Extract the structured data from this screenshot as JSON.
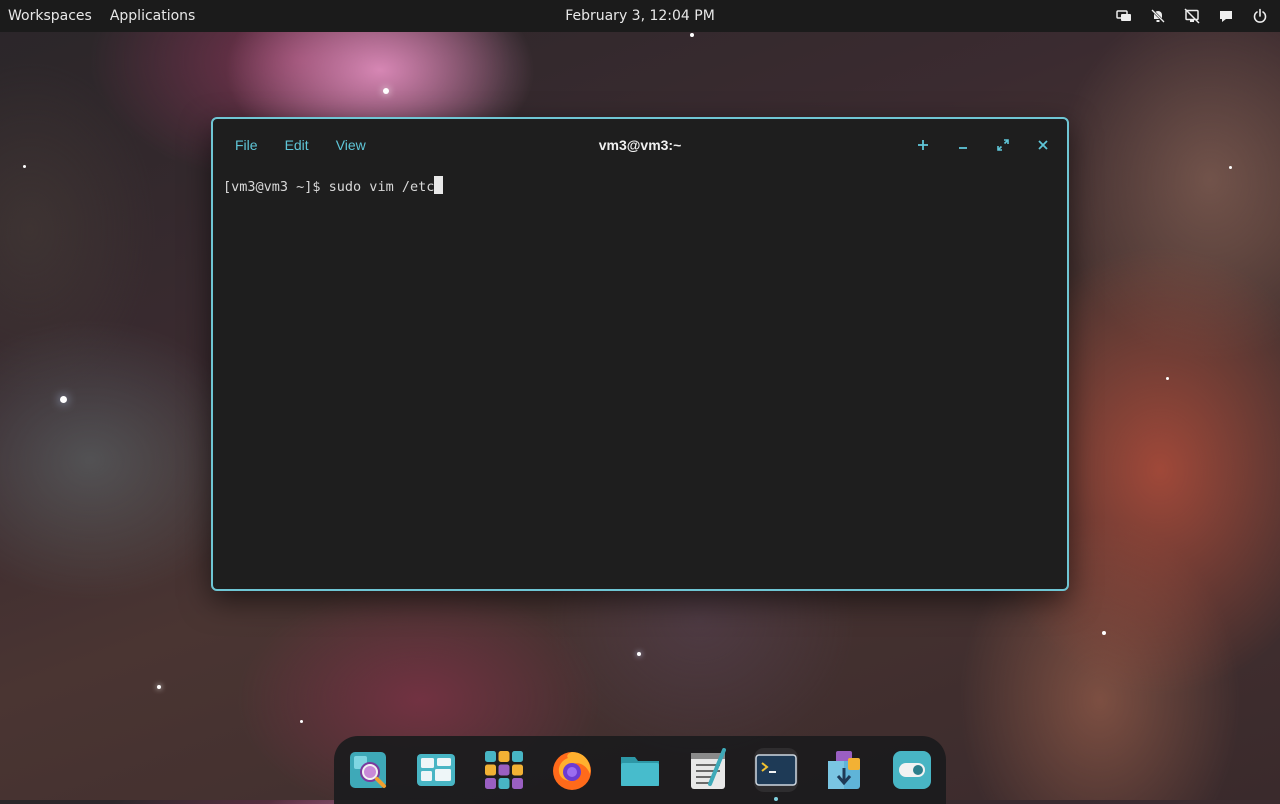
{
  "top_panel": {
    "workspaces_label": "Workspaces",
    "applications_label": "Applications",
    "clock": "February 3, 12:04 PM",
    "tray_icons": [
      "display-icon",
      "notifications-off-icon",
      "network-disconnected-icon",
      "chat-icon",
      "power-icon"
    ]
  },
  "terminal": {
    "title": "vm3@vm3:~",
    "menu": {
      "file": "File",
      "edit": "Edit",
      "view": "View"
    },
    "controls": [
      "new-tab-icon",
      "minimize-icon",
      "maximize-icon",
      "close-icon"
    ],
    "prompt": "[vm3@vm3 ~]$ ",
    "command": "sudo vim /etc",
    "accent_color": "#6fc6d4"
  },
  "dock": {
    "apps": [
      "search-app-icon",
      "workspaces-app-icon",
      "app-grid-icon",
      "firefox-icon",
      "files-icon",
      "text-editor-icon",
      "terminal-icon",
      "app-store-icon",
      "settings-toggle-icon"
    ],
    "active_app": "terminal-icon"
  }
}
